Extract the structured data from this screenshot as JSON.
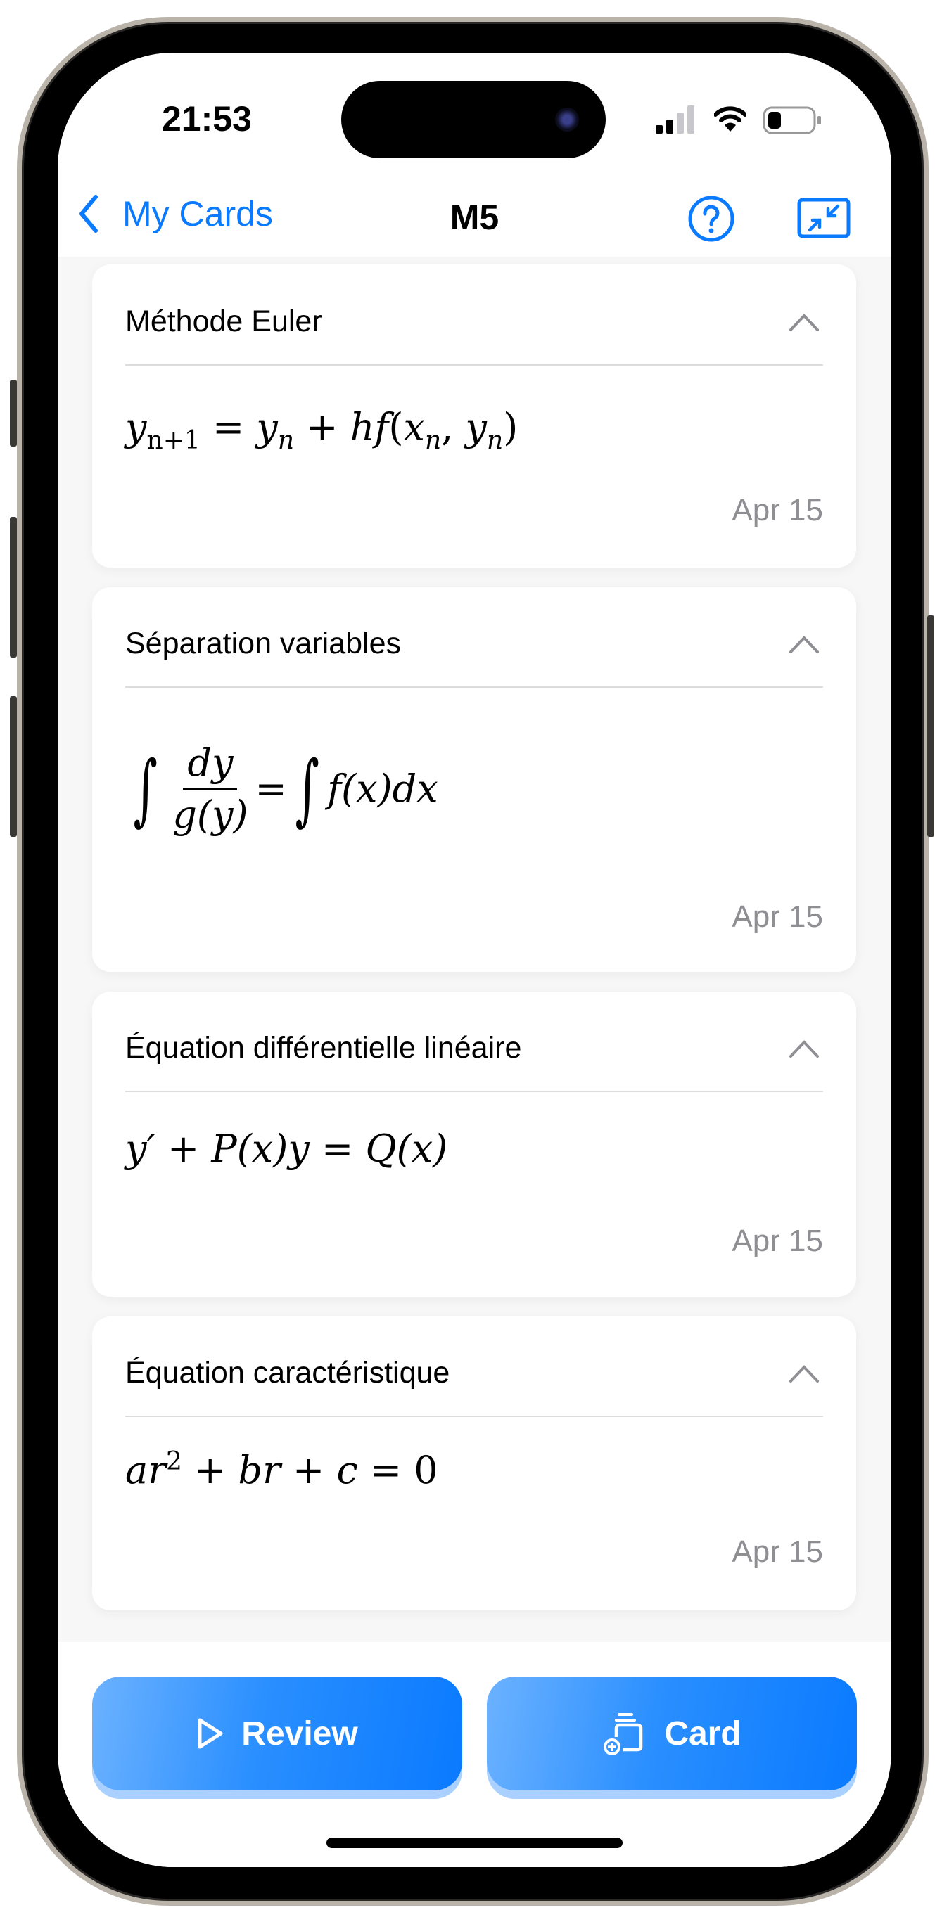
{
  "status": {
    "time": "21:53"
  },
  "nav": {
    "back_label": "My Cards",
    "title": "M5"
  },
  "cards": [
    {
      "title": "Méthode Euler",
      "date": "Apr 15",
      "formula": {
        "a": "y",
        "a_sub": "n+1",
        "b": " = ",
        "c": "y",
        "c_sub": "n",
        "d": " + ",
        "e": "hf",
        "f": "(",
        "g": "x",
        "g_sub": "n",
        "h": ", ",
        "i": "y",
        "i_sub": "n",
        "j": ")"
      }
    },
    {
      "title": "Séparation variables",
      "date": "Apr 15",
      "formula": {
        "int": "∫",
        "num": "dy",
        "den": "g(y)",
        "eq": " = ",
        "rhs": "f(x)dx"
      }
    },
    {
      "title": "Équation différentielle linéaire",
      "date": "Apr 15",
      "formula": {
        "a": "y′",
        "b": " + ",
        "c": "P(x)y",
        "d": " = ",
        "e": "Q(x)"
      }
    },
    {
      "title": "Équation caractéristique",
      "date": "Apr 15",
      "formula": {
        "a": "ar",
        "a_sup": "2",
        "b": " + ",
        "c": "br",
        "d": " + ",
        "e": "c",
        "f": " = ",
        "g": "0"
      }
    }
  ],
  "actions": {
    "review_label": "Review",
    "card_label": "Card"
  },
  "colors": {
    "accent": "#0a7aff",
    "muted": "#8e8e93"
  }
}
